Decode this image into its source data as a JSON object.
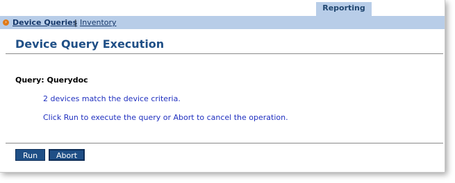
{
  "tabs": [
    {
      "label": "Reporting"
    }
  ],
  "subnav": {
    "items": [
      "Device Queries",
      "Inventory"
    ],
    "separator": "|"
  },
  "page": {
    "title": "Device Query Execution"
  },
  "query": {
    "label": "Query: Querydoc"
  },
  "messages": [
    "2 devices match the device criteria.",
    "Click Run to execute the query or Abort to cancel the operation."
  ],
  "buttons": {
    "run": "Run",
    "abort": "Abort"
  },
  "colors": {
    "accent": "#1f4f86",
    "nav_bg": "#b8cde8",
    "message_text": "#1f2fbf",
    "bullet": "#e07a18"
  },
  "icons": {
    "bullet": "chevron-right-icon"
  }
}
